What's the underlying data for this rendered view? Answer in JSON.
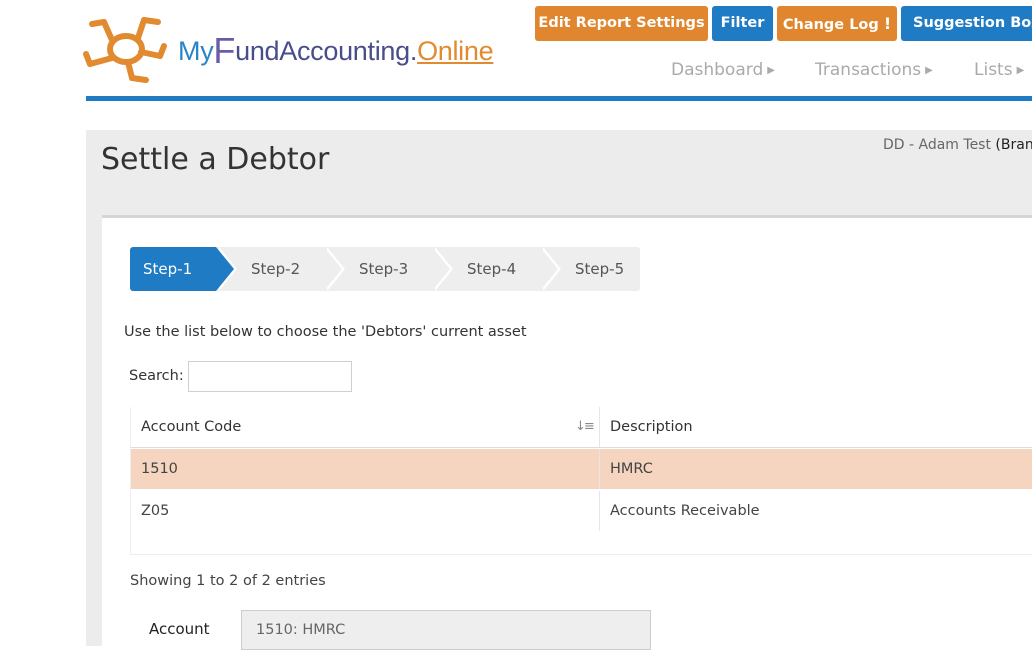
{
  "logo": {
    "part_my": "My",
    "part_f": "F",
    "part_rest": "undAccounting",
    "part_dot": ".",
    "part_online": "Online"
  },
  "toolbar": {
    "edit_report": "Edit Report Settings",
    "filter": "Filter",
    "change_log": "Change Log",
    "change_log_badge": "!",
    "suggestion": "Suggestion Box"
  },
  "nav": {
    "items": [
      {
        "label": "Dashboard"
      },
      {
        "label": "Transactions"
      },
      {
        "label": "Lists"
      }
    ]
  },
  "page": {
    "title": "Settle a Debtor",
    "user_info": "DD - Adam Test",
    "branch": "(Bran"
  },
  "wizard": {
    "steps": [
      {
        "label": "Step-1"
      },
      {
        "label": "Step-2"
      },
      {
        "label": "Step-3"
      },
      {
        "label": "Step-4"
      },
      {
        "label": "Step-5"
      }
    ]
  },
  "instructions": "Use the list below to choose the 'Debtors' current asset",
  "search": {
    "label": "Search:",
    "value": ""
  },
  "table": {
    "headers": {
      "code": "Account Code",
      "description": "Description"
    },
    "rows": [
      {
        "code": "1510",
        "description": "HMRC"
      },
      {
        "code": "Z05",
        "description": "Accounts Receivable"
      }
    ],
    "info": "Showing 1 to 2 of 2 entries"
  },
  "account_field": {
    "label": "Account",
    "value": "1510: HMRC"
  },
  "colors": {
    "orange": "#e0862e",
    "blue": "#1f7bc4",
    "selected_row": "#f5d5bf"
  },
  "icons": {
    "logo": "sun-logo-icon",
    "sort": "sort-amount-down-icon",
    "caret": "caret-right-icon"
  }
}
